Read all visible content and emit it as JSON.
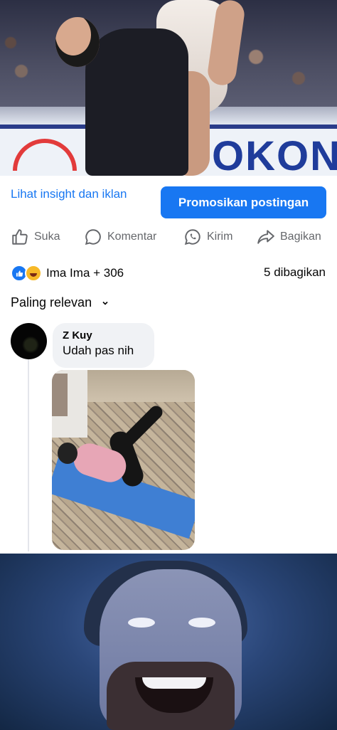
{
  "post": {
    "insight_link": "Lihat insight dan iklan",
    "promote_button": "Promosikan postingan",
    "board_text": "OKON"
  },
  "actions": {
    "like": "Suka",
    "comment": "Komentar",
    "send": "Kirim",
    "share": "Bagikan"
  },
  "reactions": {
    "summary": "Ima Ima + 306",
    "shares": "5 dibagikan"
  },
  "sort": {
    "label": "Paling relevan"
  },
  "comment": {
    "author": "Z Kuy",
    "text": "Udah pas nih"
  },
  "colors": {
    "accent": "#1877f2",
    "muted": "#65676b",
    "bubble": "#f0f2f5"
  }
}
